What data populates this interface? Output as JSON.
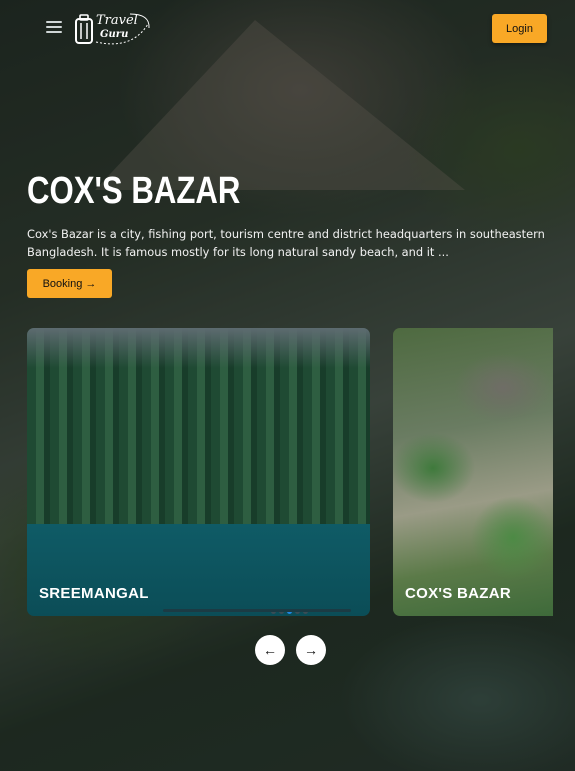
{
  "header": {
    "logo_line1": "Travel",
    "logo_line2": "Guru",
    "login_label": "Login"
  },
  "hero": {
    "title": "COX'S BAZAR",
    "description": "Cox's Bazar is a city, fishing port, tourism centre and district headquarters in southeastern Bangladesh. It is famous mostly for its long natural sandy beach, and it ...",
    "booking_label": "Booking →"
  },
  "carousel": {
    "cards": [
      {
        "label": "SREEMANGAL"
      },
      {
        "label": "COX'S BAZAR"
      }
    ],
    "prev_label": "←",
    "next_label": "→",
    "active_dot": 2,
    "dot_count": 5
  },
  "colors": {
    "accent": "#f9a826",
    "dot_active": "#1e88e5"
  },
  "icons": [
    "menu-icon",
    "luggage-logo-icon",
    "arrow-left-icon",
    "arrow-right-icon"
  ]
}
